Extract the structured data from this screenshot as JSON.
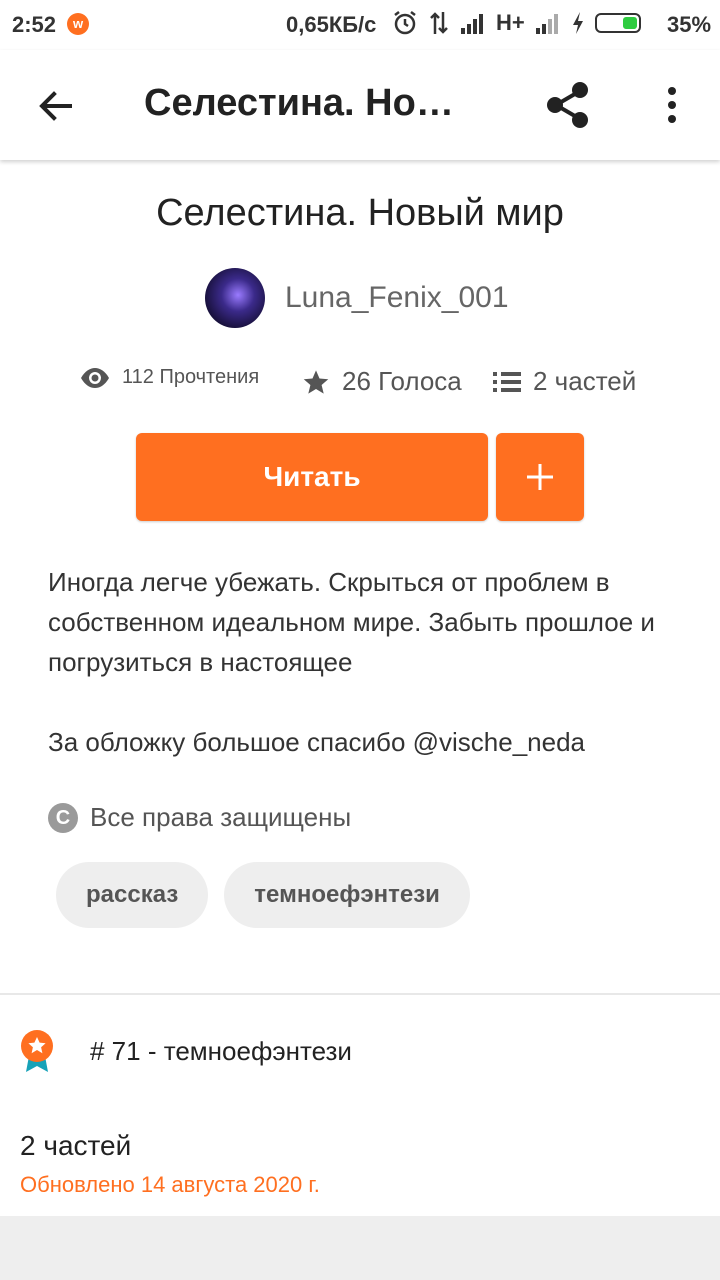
{
  "status_bar": {
    "time": "2:52",
    "network_speed": "0,65КБ/с",
    "network_type": "H+",
    "battery_percent": "35%",
    "icons": [
      "app-notification-icon",
      "alarm-icon",
      "data-transfer-icon",
      "signal-icon",
      "signal-icon",
      "charging-icon",
      "battery-icon"
    ]
  },
  "app_bar": {
    "title": "Селестина. Новый мир",
    "back_icon": "arrow-left-icon",
    "share_icon": "share-icon",
    "more_icon": "more-vertical-icon"
  },
  "story": {
    "title": "Селестина. Новый мир",
    "author": "Luna_Fenix_001",
    "stats": {
      "reads": "112 Прочтения",
      "votes": "26 Голоса",
      "parts": "2 частей"
    },
    "read_button": "Читать",
    "add_button_icon": "plus-icon",
    "description": [
      "Иногда легче убежать. Скрыться от проблем в собственном идеальном мире. Забыть прошлое и погрузиться в настоящее",
      "За обложку большое спасибо @vische_neda"
    ],
    "copyright": "Все права защищены",
    "tags": [
      "рассказ",
      "темноефэнтези"
    ],
    "ranking": "# 71 - темноефэнтези",
    "parts_count": "2 частей",
    "updated": "Обновлено 14 августа 2020 г."
  },
  "colors": {
    "accent": "#ff6f20",
    "tag_bg": "#eeeeee",
    "text_primary": "#222222",
    "text_secondary": "#666666"
  }
}
